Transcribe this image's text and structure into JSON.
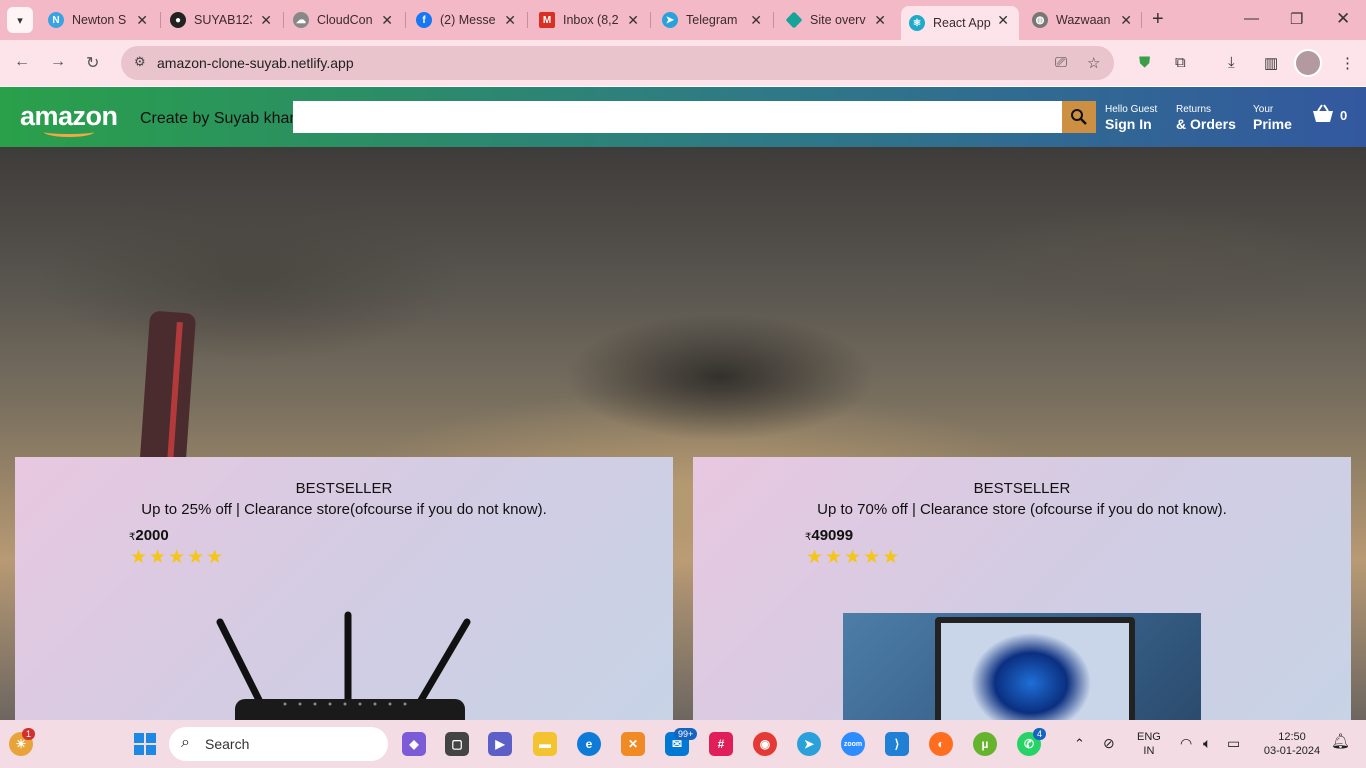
{
  "browser": {
    "tabs": [
      {
        "title": "Newton S",
        "icon": "newton-icon",
        "color": "#3aa3e3"
      },
      {
        "title": "SUYAB123",
        "icon": "github-icon",
        "color": "#222222"
      },
      {
        "title": "CloudCon",
        "icon": "cloud-icon",
        "color": "#666666"
      },
      {
        "title": "(2) Messe",
        "icon": "facebook-icon",
        "color": "#1877f2"
      },
      {
        "title": "Inbox (8,2",
        "icon": "gmail-icon",
        "color": "#d93025"
      },
      {
        "title": "Telegram",
        "icon": "telegram-icon",
        "color": "#2aa1da"
      },
      {
        "title": "Site overv",
        "icon": "netlify-icon",
        "color": "#15a39a"
      },
      {
        "title": "React App",
        "icon": "react-icon",
        "color": "#20a9c9"
      },
      {
        "title": "Wazwaan",
        "icon": "globe-icon",
        "color": "#777777"
      }
    ],
    "url": "amazon-clone-suyab.netlify.app"
  },
  "header": {
    "logo": "amazon",
    "tagline": "Create by Suyab khan",
    "search_placeholder": "",
    "options": [
      {
        "line1": "Hello Guest",
        "line2": "Sign In"
      },
      {
        "line1": "Returns",
        "line2": "& Orders"
      },
      {
        "line1": "Your",
        "line2": "Prime"
      }
    ],
    "basket_count": "0"
  },
  "products": [
    {
      "title": "BESTSELLER",
      "description": "Up to 25% off | Clearance store(ofcourse if you do not know).",
      "currency": "₹",
      "price": "2000",
      "rating": 5,
      "stars": "★★★★★",
      "image": "wifi-router"
    },
    {
      "title": "BESTSELLER",
      "description": "Up to 70% off | Clearance store (ofcourse if you do not know).",
      "currency": "₹",
      "price": "49099",
      "rating": 5,
      "stars": "★★★★★",
      "image": "laptop"
    }
  ],
  "taskbar": {
    "search_label": "Search",
    "mail_badge": "99+",
    "whatsapp_badge": "4",
    "weather_badge": "1",
    "language_line1": "ENG",
    "language_line2": "IN",
    "time": "12:50",
    "date": "03-01-2024"
  }
}
